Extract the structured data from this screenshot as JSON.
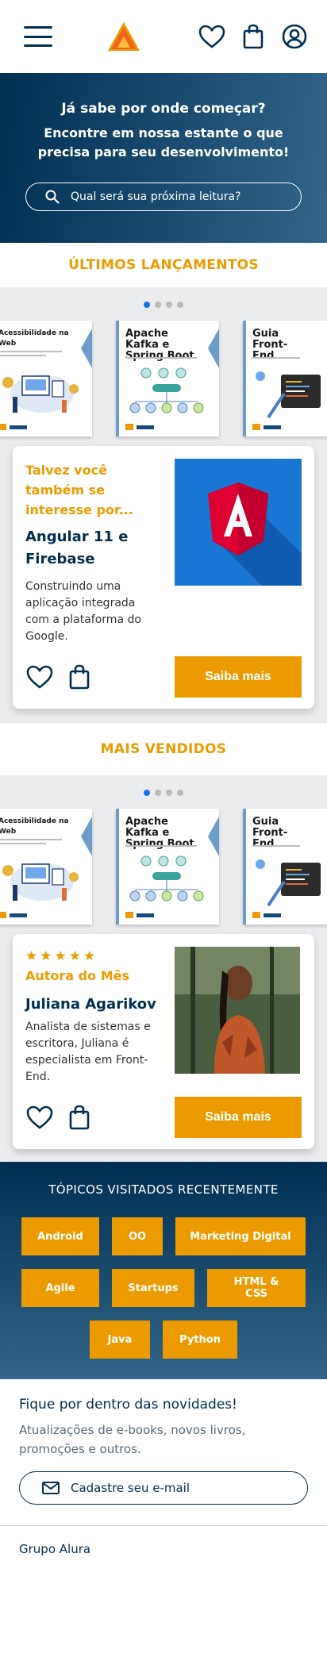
{
  "hero": {
    "title": "Já sabe por onde começar?",
    "subtitle": "Encontre em nossa estante o que precisa para seu desenvolvimento!",
    "search_placeholder": "Qual será sua próxima leitura?"
  },
  "latest": {
    "title": "ÚLTIMOS LANÇAMENTOS",
    "books": [
      {
        "title": "Acessibilidade na Web"
      },
      {
        "title": "Apache Kafka e Spring Boot"
      },
      {
        "title": "Guia Front-End"
      }
    ],
    "card": {
      "eyebrow": "Talvez você também se interesse por...",
      "name": "Angular 11 e Firebase",
      "desc": "Construindo uma aplicação integrada com a plataforma do Google.",
      "button": "Saiba mais"
    }
  },
  "best": {
    "title": "MAIS VENDIDOS",
    "books": [
      {
        "title": "Acessibilidade na Web"
      },
      {
        "title": "Apache Kafka e Spring Boot"
      },
      {
        "title": "Guia Front-End"
      }
    ],
    "card": {
      "stars": "★★★★★",
      "eyebrow": "Autora do Mês",
      "name": "Juliana Agarikov",
      "desc": "Analista de sistemas e escritora, Juliana é especialista em Front-End.",
      "button": "Saiba mais"
    }
  },
  "topics": {
    "title": "TÓPICOS VISITADOS RECENTEMENTE",
    "tags": [
      "Android",
      "OO",
      "Marketing Digital",
      "Agile",
      "Startups",
      "HTML & CSS",
      "Java",
      "Python"
    ]
  },
  "newsletter": {
    "title": "Fique por dentro das novidades!",
    "text": "Atualizações de e-books, novos livros, promoções e outros.",
    "button": "Cadastre seu e-mail"
  },
  "footer": {
    "text": "Grupo Alura"
  },
  "colors": {
    "primary": "#002f52",
    "accent": "#eb9b00",
    "dot_active": "#1875e8"
  }
}
